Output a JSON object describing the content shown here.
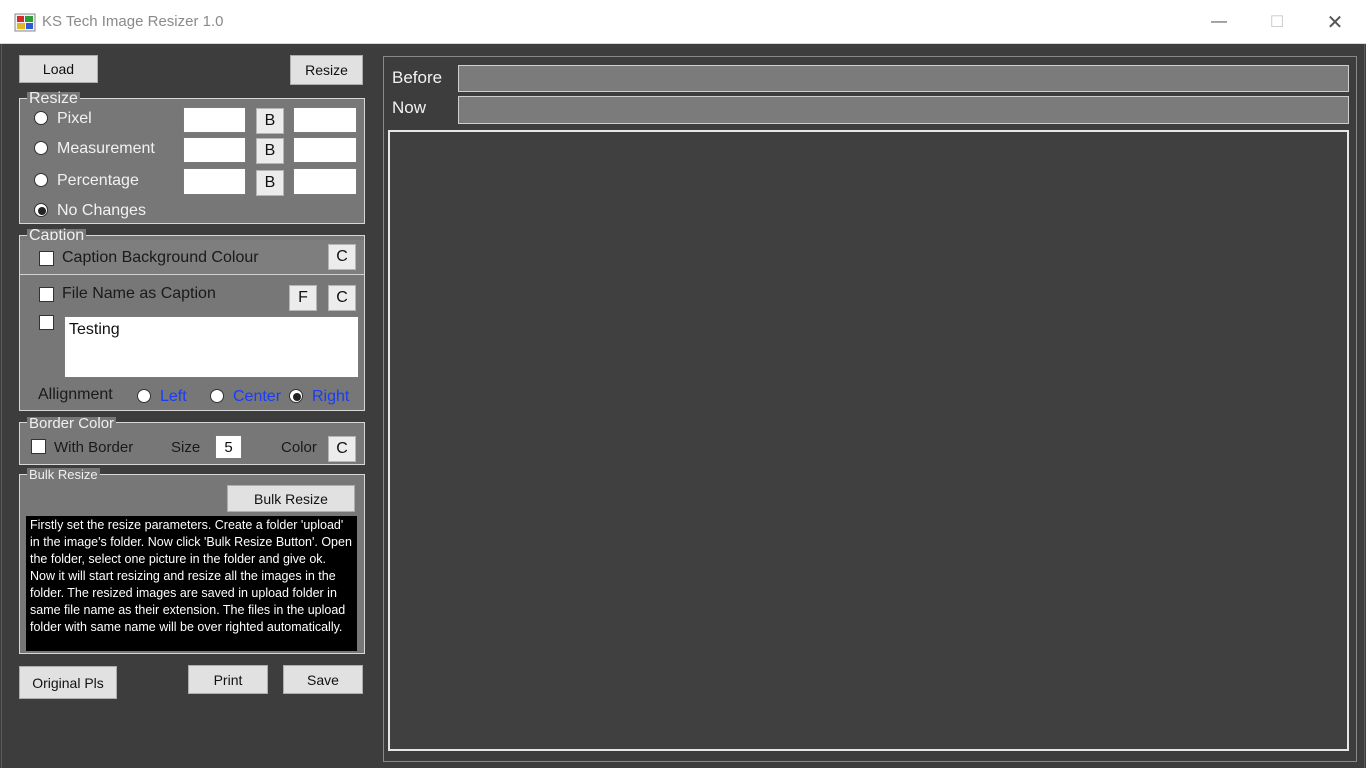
{
  "window": {
    "title": "KS Tech Image Resizer 1.0",
    "minimize_glyph": "—",
    "maximize_glyph": "☐",
    "close_glyph": "✕"
  },
  "toolbar": {
    "load_label": "Load",
    "resize_label": "Resize"
  },
  "resize": {
    "legend": "Resize",
    "pixel_label": "Pixel",
    "measurement_label": "Measurement",
    "percentage_label": "Percentage",
    "no_changes_label": "No Changes",
    "b_label": "B",
    "selected": "No Changes"
  },
  "caption": {
    "legend": "Caption",
    "bg_colour_label": "Caption Background Colour",
    "c_label": "C",
    "file_name_label": "File Name as Caption",
    "f_label": "F",
    "caption_text": "Testing",
    "alignment_label": "Allignment",
    "left_label": "Left",
    "center_label": "Center",
    "right_label": "Right",
    "alignment_selected": "Right"
  },
  "border": {
    "legend": "Border Color",
    "with_border_label": "With Border",
    "size_label": "Size",
    "size_value": "5",
    "color_label": "Color",
    "c_label": "C"
  },
  "bulk": {
    "legend": "Bulk Resize",
    "button_label": "Bulk Resize",
    "instructions": "Firstly set the resize parameters. Create a folder 'upload' in the image's folder. Now click 'Bulk Resize Button'. Open the folder, select one picture in the folder and give ok. Now it will start resizing and resize all the images in the folder. The resized images are saved in upload folder in same file name as their extension. The files in the upload folder with same name will be over righted automatically."
  },
  "bottom": {
    "original_label": "Original Pls",
    "print_label": "Print",
    "save_label": "Save"
  },
  "info": {
    "before_label": "Before",
    "now_label": "Now"
  },
  "colors": {
    "background": "#3d3d3d",
    "panel": "#777777",
    "accent_blue": "#1a3cf5"
  }
}
